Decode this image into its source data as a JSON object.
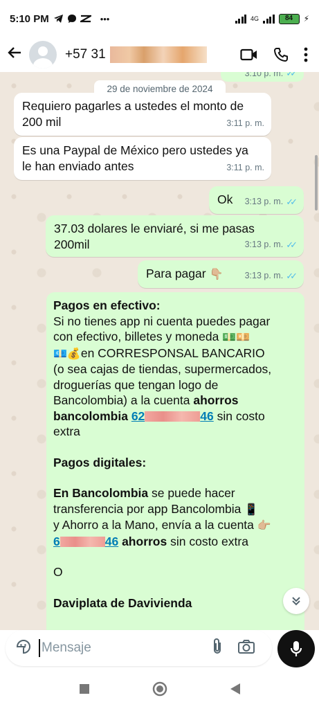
{
  "status_bar": {
    "time": "5:10 PM",
    "notification_icons": [
      "telegram-icon",
      "chat-icon",
      "capcut-icon"
    ],
    "more": "•••",
    "network": "4G",
    "battery": "84"
  },
  "header": {
    "phone_prefix": "+57 31",
    "icons": [
      "back-arrow-icon",
      "video-call-icon",
      "phone-icon",
      "more-vert-icon"
    ]
  },
  "chat": {
    "date_chip": "29 de noviembre de 2024",
    "partial_time": "3:10 p. m.",
    "messages": [
      {
        "dir": "in",
        "text1": "Requiero pagarles a ustedes el monto de",
        "text2": "200 mil",
        "time": "3:11 p. m."
      },
      {
        "dir": "in",
        "text1": "Es una Paypal de México pero ustedes ya",
        "text2": "le han enviado antes",
        "time": "3:11 p. m."
      },
      {
        "dir": "out",
        "text": "Ok",
        "time": "3:13 p. m."
      },
      {
        "dir": "out",
        "text1": "37.03 dolares le enviaré,  si me pasas",
        "text2": "200mil",
        "time": "3:13 p. m."
      },
      {
        "dir": "out",
        "text": "Para pagar",
        "emoji": "👇🏼",
        "time": "3:13 p. m."
      }
    ],
    "long_message": {
      "h1": "Pagos en efectivo:",
      "l1": "Si no tienes app ni cuenta puedes pagar",
      "l2": "con efectivo, billetes y moneda",
      "l2_emoji": "💵💴",
      "l3_emoji": "💶💰",
      "l3": "en CORRESPONSAL BANCARIO",
      "l4": "(o sea cajas de tiendas, supermercados,",
      "l5": "droguerías que tengan logo de",
      "l6": "Bancolombia) a la cuenta",
      "l6_bold": "ahorros",
      "l7_bold": "bancolombia",
      "acct1_start": "62",
      "acct1_end": "46",
      "l7_tail": "sin costo",
      "l8": "extra",
      "h2": "Pagos digitales:",
      "d1_bold": "En Bancolombia",
      "d1": "se puede hacer",
      "d2": "transferencia por app Bancolombia",
      "d2_emoji": "📱",
      "d3": "y Ahorro a la Mano, envía a la cuenta",
      "d3_emoji": "👉🏼",
      "acct2_start": "6",
      "acct2_end": "46",
      "d4_bold": "ahorros",
      "d4": "sin costo extra",
      "o": "O",
      "h3": "Daviplata de Davivienda"
    }
  },
  "composer": {
    "placeholder": "Mensaje",
    "icons": [
      "sticker-icon",
      "attach-icon",
      "camera-icon",
      "mic-icon"
    ]
  }
}
